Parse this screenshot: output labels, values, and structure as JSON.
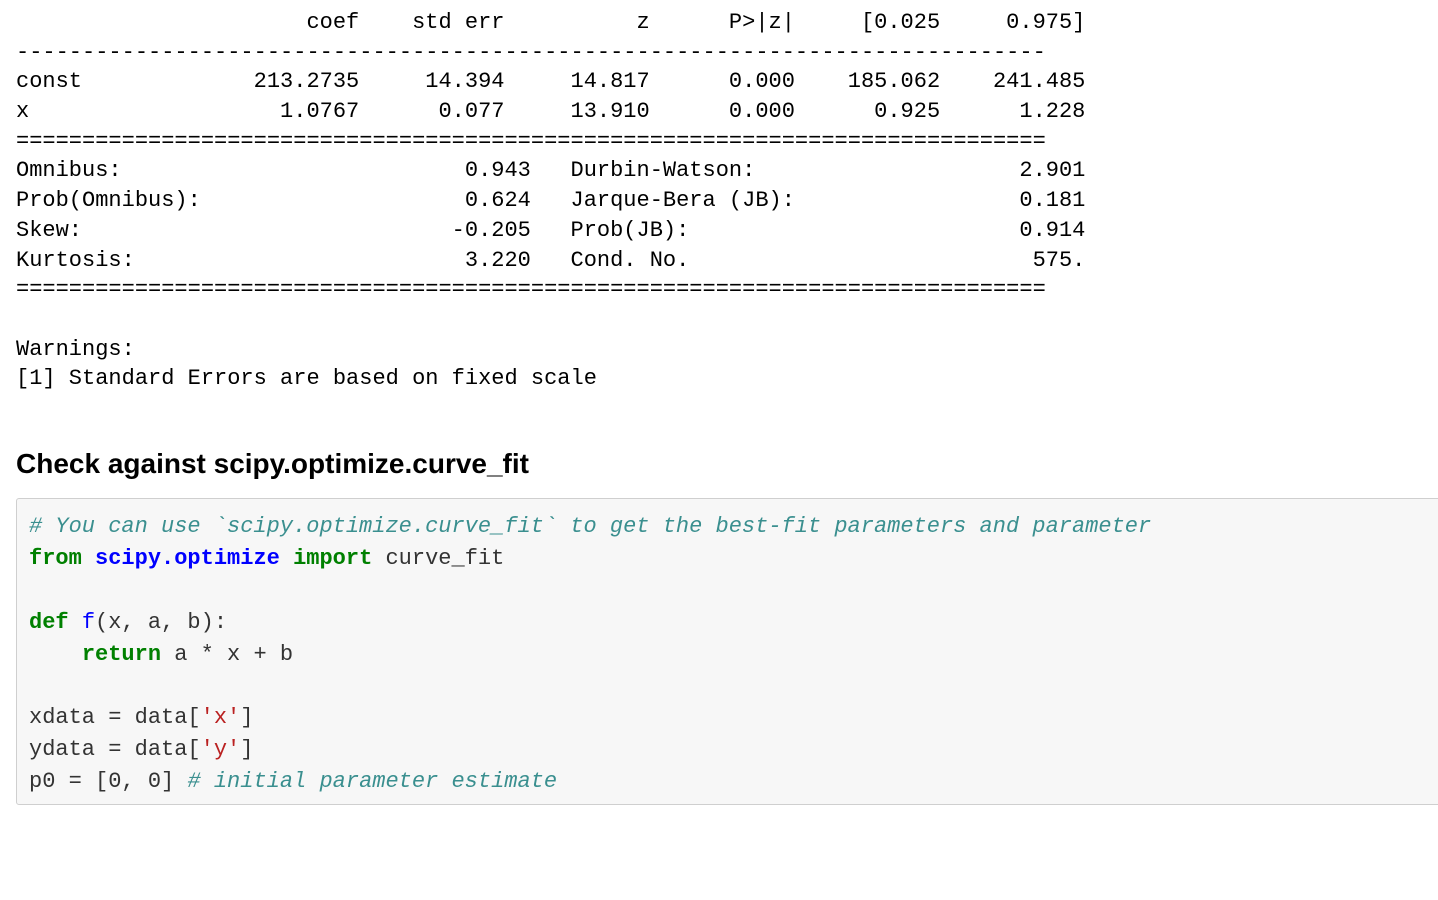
{
  "regression_output": {
    "coef_table": {
      "headers": [
        "",
        "coef",
        "std err",
        "z",
        "P>|z|",
        "[0.025",
        "0.975]"
      ],
      "rows": [
        {
          "name": "const",
          "coef": "213.2735",
          "stderr": "14.394",
          "z": "14.817",
          "p": "0.000",
          "lo": "185.062",
          "hi": "241.485"
        },
        {
          "name": "x",
          "coef": "1.0767",
          "stderr": "0.077",
          "z": "13.910",
          "p": "0.000",
          "lo": "0.925",
          "hi": "1.228"
        }
      ]
    },
    "diag_table": {
      "left": [
        [
          "Omnibus:",
          "0.943"
        ],
        [
          "Prob(Omnibus):",
          "0.624"
        ],
        [
          "Skew:",
          "-0.205"
        ],
        [
          "Kurtosis:",
          "3.220"
        ]
      ],
      "right": [
        [
          "Durbin-Watson:",
          "2.901"
        ],
        [
          "Jarque-Bera (JB):",
          "0.181"
        ],
        [
          "Prob(JB):",
          "0.914"
        ],
        [
          "Cond. No.",
          "575."
        ]
      ]
    },
    "warnings_header": "Warnings:",
    "warnings_line": "[1] Standard Errors are based on fixed scale"
  },
  "section_heading": "Check against scipy.optimize.curve_fit",
  "code": {
    "comment1": "# You can use `scipy.optimize.curve_fit` to get the best-fit parameters and parameter",
    "kw_from": "from",
    "module": "scipy.optimize",
    "kw_import": "import",
    "imported": "curve_fit",
    "kw_def": "def",
    "fn_name": "f",
    "fn_sig": "(x, a, b):",
    "kw_return": "return",
    "return_expr": " a * x + b",
    "line_xdata_a": "xdata = data[",
    "str_x": "'x'",
    "line_xdata_b": "]",
    "line_ydata_a": "ydata = data[",
    "str_y": "'y'",
    "line_ydata_b": "]",
    "p0_assign": "p0 = [0, 0] ",
    "comment2": "# initial parameter estimate"
  }
}
